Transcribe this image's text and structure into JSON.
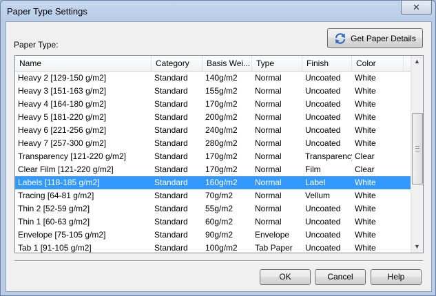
{
  "window": {
    "title": "Paper Type Settings",
    "close_glyph": "✕"
  },
  "toolbar": {
    "get_details_label": "Get Paper Details",
    "get_details_icon": "refresh-icon"
  },
  "list_label": "Paper Type:",
  "columns": [
    "Name",
    "Category",
    "Basis Wei...",
    "Type",
    "Finish",
    "Color"
  ],
  "rows": [
    {
      "name": "Heavy 2 [129-150 g/m2]",
      "category": "Standard",
      "basis": "140g/m2",
      "type": "Normal",
      "finish": "Uncoated",
      "color": "White"
    },
    {
      "name": "Heavy 3 [151-163 g/m2]",
      "category": "Standard",
      "basis": "155g/m2",
      "type": "Normal",
      "finish": "Uncoated",
      "color": "White"
    },
    {
      "name": "Heavy 4 [164-180 g/m2]",
      "category": "Standard",
      "basis": "170g/m2",
      "type": "Normal",
      "finish": "Uncoated",
      "color": "White"
    },
    {
      "name": "Heavy 5 [181-220 g/m2]",
      "category": "Standard",
      "basis": "200g/m2",
      "type": "Normal",
      "finish": "Uncoated",
      "color": "White"
    },
    {
      "name": "Heavy 6 [221-256 g/m2]",
      "category": "Standard",
      "basis": "240g/m2",
      "type": "Normal",
      "finish": "Uncoated",
      "color": "White"
    },
    {
      "name": "Heavy 7 [257-300 g/m2]",
      "category": "Standard",
      "basis": "280g/m2",
      "type": "Normal",
      "finish": "Uncoated",
      "color": "White"
    },
    {
      "name": "Transparency [121-220 g/m2]",
      "category": "Standard",
      "basis": "170g/m2",
      "type": "Normal",
      "finish": "Transparency",
      "color": "Clear"
    },
    {
      "name": "Clear Film [121-220 g/m2]",
      "category": "Standard",
      "basis": "170g/m2",
      "type": "Normal",
      "finish": "Film",
      "color": "Clear"
    },
    {
      "name": "Labels [118-185 g/m2]",
      "category": "Standard",
      "basis": "160g/m2",
      "type": "Normal",
      "finish": "Label",
      "color": "White",
      "selected": true
    },
    {
      "name": "Tracing [64-81 g/m2]",
      "category": "Standard",
      "basis": "70g/m2",
      "type": "Normal",
      "finish": "Vellum",
      "color": "White"
    },
    {
      "name": "Thin 2 [52-59 g/m2]",
      "category": "Standard",
      "basis": "55g/m2",
      "type": "Normal",
      "finish": "Uncoated",
      "color": "White"
    },
    {
      "name": "Thin 1 [60-63 g/m2]",
      "category": "Standard",
      "basis": "60g/m2",
      "type": "Normal",
      "finish": "Uncoated",
      "color": "White"
    },
    {
      "name": "Envelope [75-105 g/m2]",
      "category": "Standard",
      "basis": "90g/m2",
      "type": "Envelope",
      "finish": "Uncoated",
      "color": "White"
    },
    {
      "name": "Tab 1 [91-105 g/m2]",
      "category": "Standard",
      "basis": "100g/m2",
      "type": "Tab Paper",
      "finish": "Uncoated",
      "color": "White"
    }
  ],
  "buttons": {
    "ok": "OK",
    "cancel": "Cancel",
    "help": "Help"
  },
  "colors": {
    "selection": "#3399ff"
  }
}
